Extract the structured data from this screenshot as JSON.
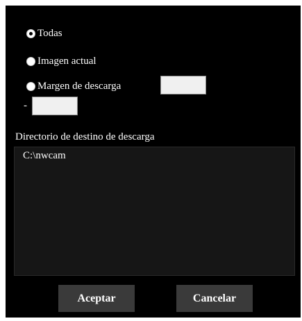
{
  "options": [
    {
      "label": "Todas",
      "checked": true
    },
    {
      "label": "Imagen actual",
      "checked": false
    },
    {
      "label": "Margen de descarga",
      "checked": false
    }
  ],
  "range": {
    "start_value": "",
    "separator": "-",
    "end_value": ""
  },
  "directory": {
    "label": "Directorio de destino de descarga",
    "path": "C:\\nwcam"
  },
  "buttons": {
    "accept": "Aceptar",
    "cancel": "Cancelar"
  }
}
